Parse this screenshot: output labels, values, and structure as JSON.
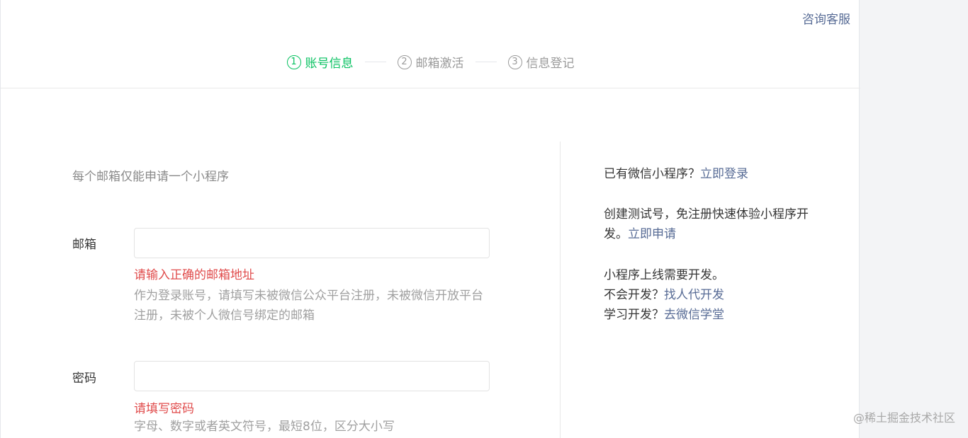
{
  "header": {
    "support_link": "咨询客服"
  },
  "steps": [
    {
      "number": "1",
      "label": "账号信息",
      "active": true
    },
    {
      "number": "2",
      "label": "邮箱激活",
      "active": false
    },
    {
      "number": "3",
      "label": "信息登记",
      "active": false
    }
  ],
  "form": {
    "notice": "每个邮箱仅能申请一个小程序",
    "email": {
      "label": "邮箱",
      "value": "",
      "placeholder": "",
      "error": "请输入正确的邮箱地址",
      "hint": "作为登录账号，请填写未被微信公众平台注册，未被微信开放平台注册，未被个人微信号绑定的邮箱"
    },
    "password": {
      "label": "密码",
      "value": "",
      "placeholder": "",
      "error": "请填写密码",
      "hint": "字母、数字或者英文符号，最短8位，区分大小写"
    }
  },
  "sidebar": {
    "existing_prefix": "已有微信小程序？",
    "existing_link": "立即登录",
    "test_text": "创建测试号，免注册快速体验小程序开发。",
    "test_link": "立即申请",
    "dev_line1": "小程序上线需要开发。",
    "dev_line2_prefix": "不会开发？",
    "dev_line2_link": "找人代开发",
    "dev_line3_prefix": "学习开发？",
    "dev_line3_link": "去微信学堂"
  },
  "watermark": "@稀土掘金技术社区",
  "colors": {
    "accent_green": "#07c160",
    "link_blue": "#576b95",
    "error_red": "#e04b4b"
  }
}
